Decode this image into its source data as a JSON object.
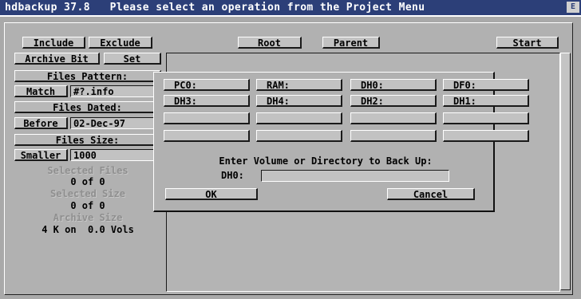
{
  "titlebar": {
    "text": "hdbackup 37.8   Please select an operation from the Project Menu",
    "depth_gadget": "E"
  },
  "left_panel": {
    "include": "Include",
    "exclude": "Exclude",
    "archive_bit": "Archive Bit",
    "set": "Set",
    "files_pattern_label": "Files Pattern:",
    "match": "Match",
    "pattern_value": "#?.info",
    "files_dated_label": "Files Dated:",
    "before": "Before",
    "date_value": "02-Dec-97",
    "files_size_label": "Files Size:",
    "smaller": "Smaller",
    "size_value": "1000",
    "selected_files_label": "Selected Files",
    "selected_files_value": "0 of 0",
    "selected_size_label": "Selected Size",
    "selected_size_value": "0 of 0",
    "archive_size_label": "Archive Size",
    "archive_size_value": "4 K on  0.0 Vols"
  },
  "top_buttons": {
    "root": "Root",
    "parent": "Parent",
    "start": "Start"
  },
  "dialog": {
    "volumes": [
      "PC0:",
      "RAM:",
      "DH0:",
      "DF0:",
      "DH3:",
      "DH4:",
      "DH2:",
      "DH1:",
      "",
      "",
      "",
      "",
      "",
      "",
      "",
      ""
    ],
    "prompt": "Enter Volume or Directory to Back Up:",
    "path_label": "DH0:",
    "path_value": "",
    "ok": "OK",
    "cancel": "Cancel"
  }
}
